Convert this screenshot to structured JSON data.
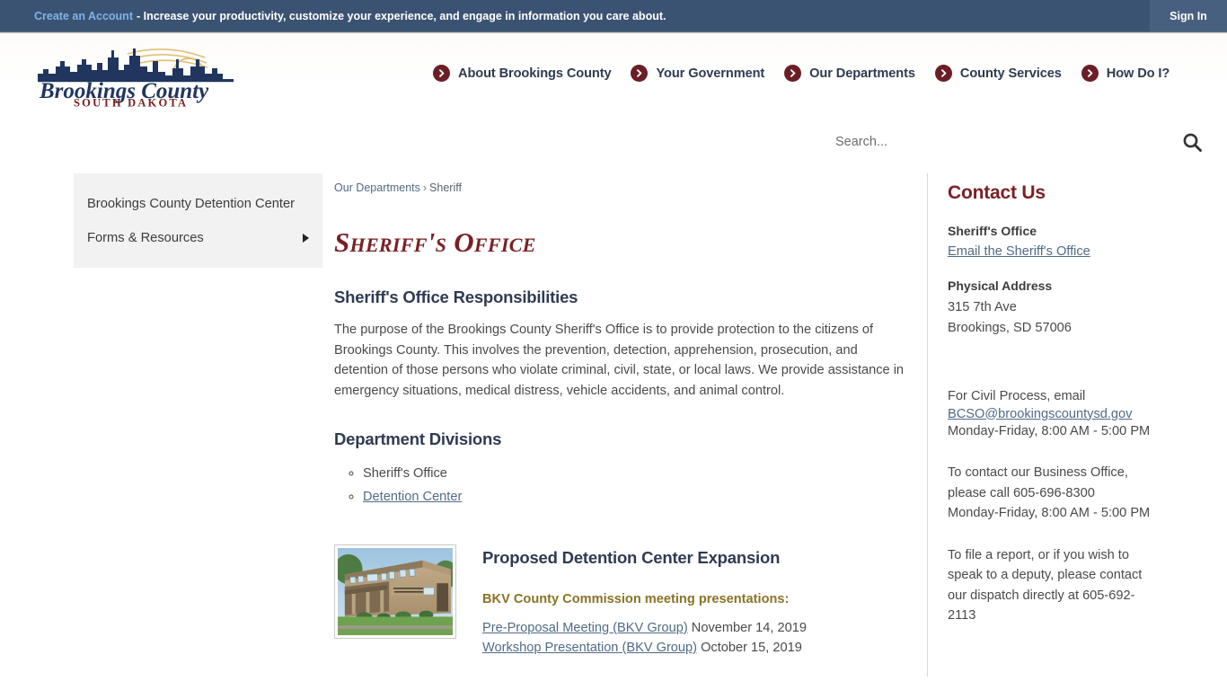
{
  "top_bar": {
    "create_account_label": "Create an Account",
    "tagline": "- Increase your productivity, customize your experience, and engage in information you care about.",
    "sign_in_label": "Sign In"
  },
  "logo": {
    "line1": "Brookings County",
    "line2": "SOUTH DAKOTA"
  },
  "nav": {
    "items": [
      {
        "label": "About Brookings County",
        "icon": "chevron-right-circle-icon"
      },
      {
        "label": "Your Government",
        "icon": "chevron-right-circle-icon"
      },
      {
        "label": "Our Departments",
        "icon": "chevron-right-circle-icon"
      },
      {
        "label": "County Services",
        "icon": "chevron-right-circle-icon"
      },
      {
        "label": "How Do I?",
        "icon": "chevron-right-circle-icon"
      }
    ]
  },
  "search": {
    "placeholder": "Search...",
    "value": "",
    "icon": "search-icon"
  },
  "sidebar": {
    "items": [
      {
        "label": "Brookings County Detention Center",
        "has_arrow": false
      },
      {
        "label": "Forms & Resources",
        "has_arrow": true
      }
    ]
  },
  "breadcrumb": {
    "parent": "Our Departments",
    "separator": "›",
    "current": "Sheriff"
  },
  "main": {
    "title": "Sheriff's Office",
    "responsibilities_heading": "Sheriff's Office Responsibilities",
    "responsibilities_text": "The purpose of the Brookings County Sheriff's Office is to provide  protection to the citizens of Brookings County. This involves the  prevention, detection, apprehension, prosecution, and detention of those  persons who violate criminal, civil, state, or local laws. We provide  assistance in emergency situations, medical distress, vehicle accidents, and animal control.",
    "divisions_heading": "Department Divisions",
    "divisions": [
      {
        "label": "Sheriff's Office",
        "is_link": false
      },
      {
        "label": "Detention Center",
        "is_link": true
      }
    ],
    "expansion": {
      "photo_alt": "brookings-county-sheriff-department-building-photo",
      "title": "Proposed Detention Center Expansion",
      "subtitle": "BKV County Commission meeting presentations:",
      "presentations": [
        {
          "link": "Pre-Proposal Meeting (BKV Group)",
          "date": " November 14, 2019"
        },
        {
          "link": "Workshop Presentation (BKV Group)",
          "date": " October 15, 2019"
        }
      ]
    }
  },
  "rail": {
    "heading": "Contact Us",
    "office_label": "Sheriff's Office",
    "email_link": "Email the Sheriff's Office",
    "address_label": "Physical Address",
    "address_line1": "315 7th Ave",
    "address_line2": "Brookings, SD 57006",
    "civil_process_intro": "For Civil Process, email",
    "civil_process_email": "BCSO@brookingscountysd.gov",
    "civil_process_hours": "Monday-Friday, 8:00 AM - 5:00 PM",
    "business_office_text": "To contact our Business Office, please call 605-696-8300",
    "business_office_hours": "Monday-Friday, 8:00 AM - 5:00 PM",
    "dispatch_text": "To file a report, or if you wish to speak to a deputy, please contact our dispatch directly at 605-692-2113"
  },
  "colors": {
    "topbar_navy": "#3b5372",
    "accent_maroon": "#6b1f25",
    "title_maroon": "#7a2024",
    "nav_text_navy": "#2f3b52",
    "link_blue": "#4f6b86",
    "gold": "#8a7327",
    "sidebar_gray": "#f2f2f2"
  }
}
